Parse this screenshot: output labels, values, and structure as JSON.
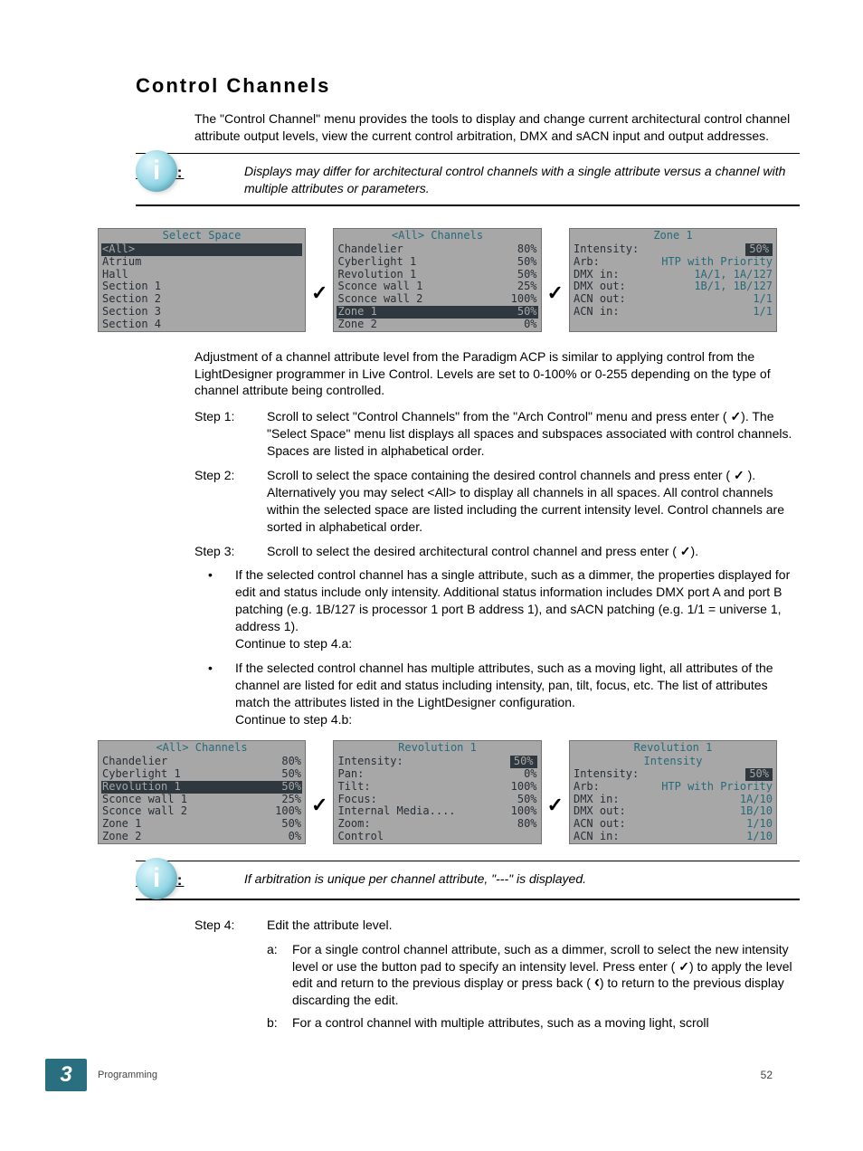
{
  "heading": "Control Channels",
  "intro": "The \"Control Channel\" menu provides the tools to display and change current architectural control channel attribute output levels, view the current control arbitration, DMX and sACN input and output addresses.",
  "note1_label": "Note:",
  "note1_text": "Displays may differ for architectural control channels with a single attribute versus a channel with multiple attributes or parameters.",
  "panels_a": {
    "p1": {
      "title": "Select Space",
      "rows": [
        "<All>",
        "Atrium",
        "Hall",
        "Section 1",
        "Section 2",
        "Section 3",
        "Section 4"
      ]
    },
    "p2": {
      "title": "<All> Channels",
      "rows": [
        {
          "l": "Chandelier",
          "r": "80%"
        },
        {
          "l": "Cyberlight 1",
          "r": "50%"
        },
        {
          "l": "Revolution 1",
          "r": "50%"
        },
        {
          "l": "Sconce wall 1",
          "r": "25%"
        },
        {
          "l": "Sconce wall 2",
          "r": "100%"
        },
        {
          "l": "Zone 1",
          "r": "50%",
          "sel": true
        },
        {
          "l": "Zone 2",
          "r": "0%"
        }
      ]
    },
    "p3": {
      "title": "Zone 1",
      "rows": [
        {
          "l": "Intensity:",
          "r": "50%",
          "inv": true
        },
        {
          "l": "Arb:",
          "r": "HTP with Priority",
          "teal": true
        },
        {
          "l": "DMX in:",
          "r": "1A/1, 1A/127",
          "teal": true
        },
        {
          "l": "DMX out:",
          "r": "1B/1, 1B/127",
          "teal": true
        },
        {
          "l": "ACN out:",
          "r": "1/1",
          "teal": true
        },
        {
          "l": "ACN in:",
          "r": "1/1",
          "teal": true
        }
      ]
    }
  },
  "para2": "Adjustment of a channel attribute level from the Paradigm ACP is similar to applying control from the LightDesigner programmer in Live Control. Levels are set to 0-100% or 0-255 depending on the type of channel attribute being controlled.",
  "steps": {
    "s1_label": "Step 1:",
    "s1_a": "Scroll to select \"Control Channels\" from the \"Arch Control\" menu and press enter (",
    "s1_b": "). The \"Select Space\" menu list displays all spaces and subspaces associated with control channels. Spaces are listed in alphabetical order.",
    "s2_label": "Step 2:",
    "s2_a": "Scroll to select the space containing the desired control channels and press enter (",
    "s2_b": "). Alternatively you may select <All> to display all channels in all spaces. All control channels within the selected space are listed including the current intensity level. Control channels are sorted in alphabetical order.",
    "s3_label": "Step 3:",
    "s3_a": "Scroll to select the desired architectural control channel and press enter (",
    "s3_b": ")."
  },
  "bullets": {
    "b1": "If the selected control channel has a single attribute, such as a dimmer, the properties displayed for edit and status include only intensity. Additional status information includes DMX port A and port B patching (e.g. 1B/127 is processor 1 port B address 1), and sACN patching (e.g. 1/1 = universe 1, address 1).",
    "b1c": "Continue to step 4.a:",
    "b2": "If the selected control channel has multiple attributes, such as a moving light, all attributes of the channel are listed for edit and status including intensity, pan, tilt, focus, etc. The list of attributes match the attributes listed in the LightDesigner configuration.",
    "b2c": "Continue to step 4.b:"
  },
  "panels_b": {
    "p1": {
      "title": "<All> Channels",
      "rows": [
        {
          "l": "Chandelier",
          "r": "80%"
        },
        {
          "l": "Cyberlight 1",
          "r": "50%"
        },
        {
          "l": "Revolution 1",
          "r": "50%",
          "sel": true
        },
        {
          "l": "Sconce wall 1",
          "r": "25%"
        },
        {
          "l": "Sconce wall 2",
          "r": "100%"
        },
        {
          "l": "Zone 1",
          "r": "50%"
        },
        {
          "l": "Zone 2",
          "r": "0%"
        }
      ]
    },
    "p2": {
      "title": "Revolution 1",
      "rows": [
        {
          "l": "Intensity:",
          "r": "50%",
          "inv": true
        },
        {
          "l": "Pan:",
          "r": "0%"
        },
        {
          "l": "Tilt:",
          "r": "100%"
        },
        {
          "l": "Focus:",
          "r": "50%"
        },
        {
          "l": "Internal Media....",
          "r": "100%"
        },
        {
          "l": "Zoom:",
          "r": "80%"
        },
        {
          "l": "Control",
          "r": ""
        }
      ]
    },
    "p3": {
      "title": "Revolution 1",
      "subtitle": "Intensity",
      "rows": [
        {
          "l": "Intensity:",
          "r": "50%",
          "inv": true
        },
        {
          "l": "Arb:",
          "r": "HTP with Priority",
          "teal": true
        },
        {
          "l": "DMX in:",
          "r": "1A/10",
          "teal": true
        },
        {
          "l": "DMX out:",
          "r": "1B/10",
          "teal": true
        },
        {
          "l": "ACN out:",
          "r": "1/10",
          "teal": true
        },
        {
          "l": "ACN in:",
          "r": "1/10",
          "teal": true
        }
      ]
    }
  },
  "note2_label": "Note:",
  "note2_text": "If arbitration is unique per channel attribute, \"---\" is displayed.",
  "step4": {
    "label": "Step 4:",
    "text": "Edit the attribute level.",
    "a_lbl": "a:",
    "a_1": "For a single control channel attribute, such as a dimmer, scroll to select the new intensity level or use the button pad to specify an intensity level. Press enter (",
    "a_2": ") to apply the level edit and return to the previous display or press back (",
    "a_3": ") to return to the previous display discarding the edit.",
    "b_lbl": "b:",
    "b": "For a control channel with multiple attributes, such as a moving light, scroll"
  },
  "footer": {
    "chapter_num": "3",
    "chapter_label": "Programming",
    "page": "52"
  }
}
